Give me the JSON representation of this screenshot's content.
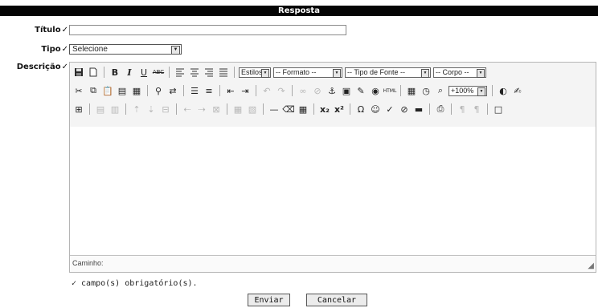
{
  "header": {
    "title": "Resposta"
  },
  "form": {
    "titulo_label": "Título",
    "tipo_label": "Tipo",
    "descricao_label": "Descrição",
    "required_mark": "✓",
    "titulo_value": "",
    "tipo_selected": "Selecione"
  },
  "editor": {
    "dropdowns": {
      "estilos": "Estilos",
      "formato": "-- Formato --",
      "fonte": "-- Tipo de Fonte --",
      "corpo": "-- Corpo --",
      "zoom": "+100%"
    },
    "status_path": "Caminho:",
    "content": ""
  },
  "footer": {
    "required_note": "✓ campo(s) obrigatório(s).",
    "submit_label": "Enviar",
    "cancel_label": "Cancelar"
  }
}
